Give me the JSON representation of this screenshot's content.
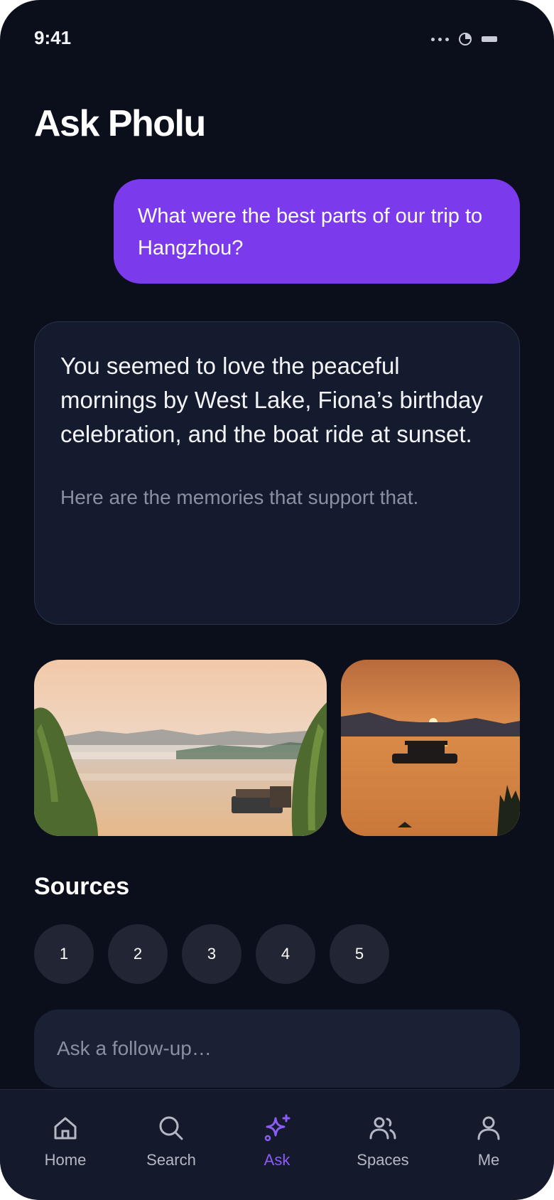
{
  "status_bar": {
    "time": "9:41"
  },
  "header": {
    "title": "Ask Pholu"
  },
  "conversation": {
    "question": "What were the best parts of our trip to Hangzhou?",
    "answer": "You seemed to love the peaceful mornings by West Lake, Fiona’s birthday celebration, and the boat ride at sunset.",
    "answer_note": "Here are the memories that support that."
  },
  "photos": [
    {
      "icon": "misty-lake-photo"
    },
    {
      "icon": "sunset-boat-photo"
    }
  ],
  "sources": {
    "title": "Sources",
    "items": [
      "1",
      "2",
      "3",
      "4",
      "5"
    ]
  },
  "followup": {
    "placeholder": "Ask a follow-up…"
  },
  "tabs": [
    {
      "label": "Home",
      "icon": "home-icon",
      "active": false
    },
    {
      "label": "Search",
      "icon": "search-icon",
      "active": false
    },
    {
      "label": "Ask",
      "icon": "sparkle-icon",
      "active": true
    },
    {
      "label": "Spaces",
      "icon": "people-icon",
      "active": false
    },
    {
      "label": "Me",
      "icon": "person-icon",
      "active": false
    }
  ],
  "colors": {
    "background": "#0b0f1c",
    "accent": "#7c3aed",
    "active_tab": "#8b5cf6",
    "card": "#151b2e"
  }
}
